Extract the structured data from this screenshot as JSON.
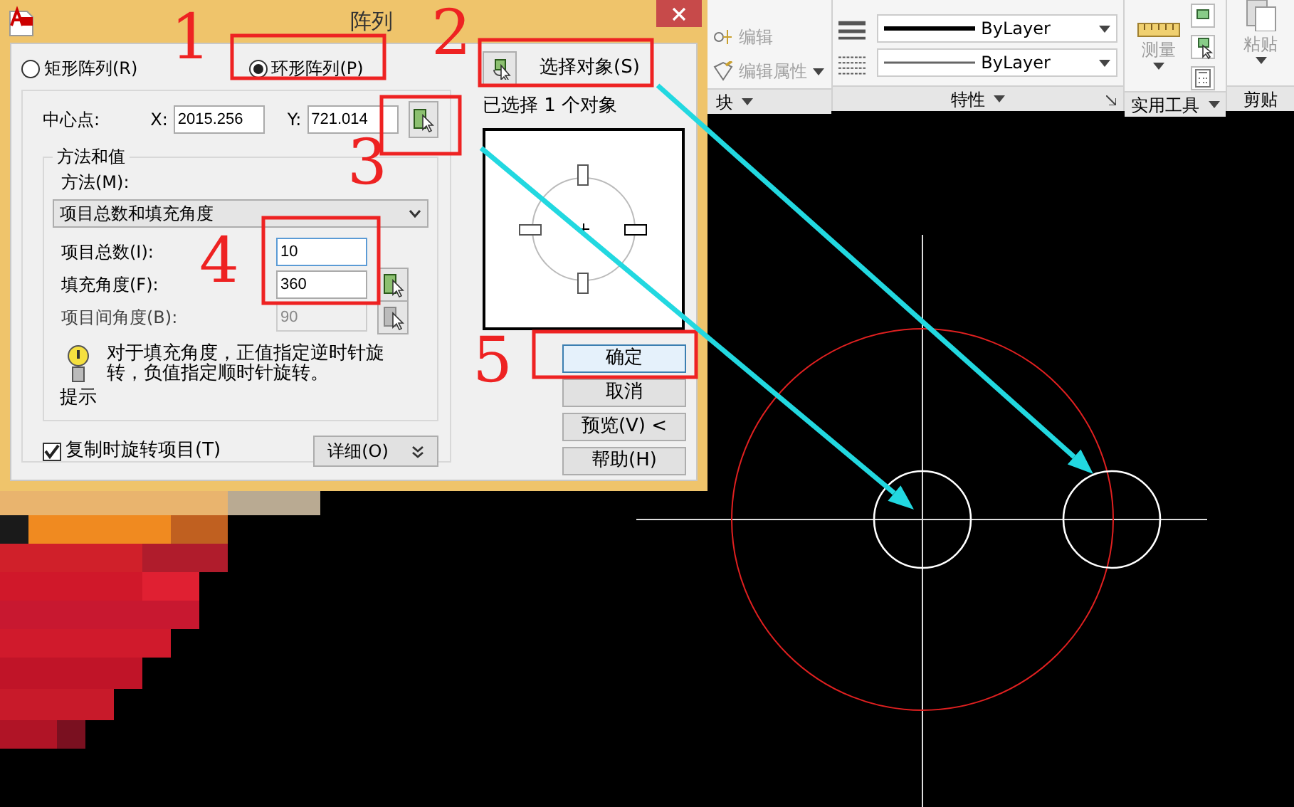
{
  "dialog": {
    "title": "阵列",
    "array_types": [
      {
        "label": "矩形阵列(R)",
        "selected": false
      },
      {
        "label": "环形阵列(P)",
        "selected": true
      }
    ],
    "center_point": {
      "label": "中心点:",
      "x_label": "X:",
      "x_value": "2015.256",
      "y_label": "Y:",
      "y_value": "721.014"
    },
    "method_group": {
      "legend": "方法和值",
      "method_label": "方法(M):",
      "method_value": "项目总数和填充角度",
      "fields": [
        {
          "label": "项目总数(I):",
          "value": "10",
          "disabled": false,
          "pick_button": false
        },
        {
          "label": "填充角度(F):",
          "value": "360",
          "disabled": false,
          "pick_button": true
        },
        {
          "label": "项目间角度(B):",
          "value": "90",
          "disabled": true,
          "pick_button": true
        }
      ],
      "tip": {
        "text": "对于填充角度，正值指定逆时针旋转，负值指定顺时针旋转。",
        "caption": "提示"
      }
    },
    "rotate_items": {
      "label": "复制时旋转项目(T)",
      "checked": true
    },
    "details_button": "详细(O)",
    "select_objects_label": "选择对象(S)",
    "selection_status": "已选择 1 个对象",
    "buttons": [
      {
        "label": "确定",
        "default": true
      },
      {
        "label": "取消",
        "default": false
      },
      {
        "label": "预览(V) <",
        "default": false
      },
      {
        "label": "帮助(H)",
        "default": false
      }
    ]
  },
  "ribbon": {
    "block_panel": {
      "title": "块",
      "items": [
        {
          "label": "编辑",
          "disabled": true
        },
        {
          "label": "编辑属性",
          "disabled": true
        }
      ]
    },
    "properties_panel": {
      "title": "特性",
      "dropdowns": [
        {
          "value": "ByLayer"
        },
        {
          "value": "ByLayer"
        }
      ]
    },
    "utilities_panel": {
      "title": "实用工具",
      "tool": "测量"
    },
    "clipboard_panel": {
      "title": "剪贴",
      "tool": "粘贴"
    }
  },
  "annotations": [
    {
      "label": "1"
    },
    {
      "label": "2"
    },
    {
      "label": "3"
    },
    {
      "label": "4"
    },
    {
      "label": "5"
    }
  ]
}
